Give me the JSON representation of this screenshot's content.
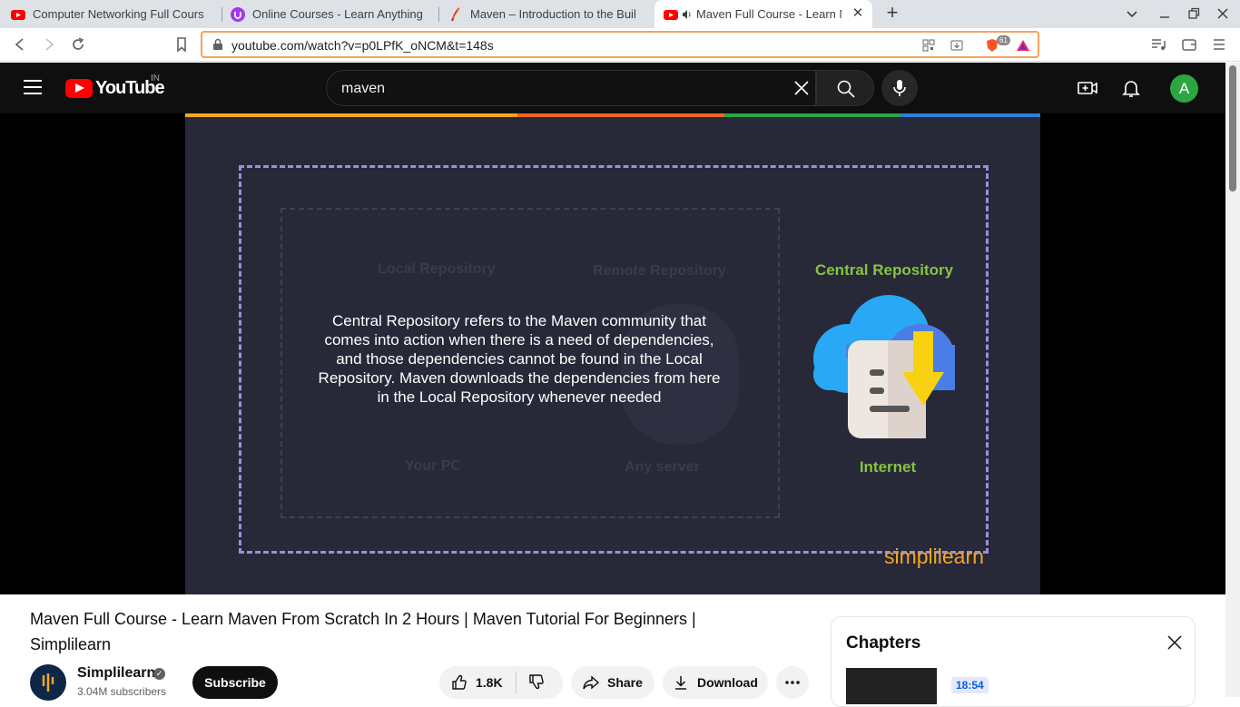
{
  "browser": {
    "tabs": [
      {
        "title": "Computer Networking Full Cours",
        "icon": "youtube-icon"
      },
      {
        "title": "Online Courses - Learn Anything",
        "icon": "udemy-icon"
      },
      {
        "title": "Maven – Introduction to the Buil",
        "icon": "maven-feather-icon"
      },
      {
        "title": "Maven Full Course - Learn M",
        "icon": "youtube-icon",
        "active": true
      }
    ],
    "url": "youtube.com/watch?v=p0LPfK_oNCM&t=148s",
    "brave_shield_count": "61"
  },
  "youtube": {
    "logo_text": "YouTube",
    "country_code": "IN",
    "search_query": "maven",
    "avatar_letter": "A"
  },
  "video": {
    "faded_labels": {
      "local_repo": "Local Repository",
      "remote_repo": "Remote Repository",
      "your_pc": "Your PC",
      "any_server": "Any server"
    },
    "overlay_text": "Central Repository refers to the Maven community that comes into action when there is a need of dependencies, and those dependencies cannot be found in the Local Repository. Maven downloads the dependencies from here in the Local Repository whenever needed",
    "central_repo_label": "Central Repository",
    "internet_label": "Internet",
    "brand": "simplilearn",
    "accent_colors": [
      "#f5a623",
      "#f26522",
      "#27a844",
      "#2e7de0"
    ]
  },
  "meta": {
    "title": "Maven Full Course - Learn Maven From Scratch In 2 Hours | Maven Tutorial For Beginners | Simplilearn",
    "channel": "Simplilearn",
    "subscribers": "3.04M subscribers",
    "subscribe_label": "Subscribe",
    "likes": "1.8K",
    "share_label": "Share",
    "download_label": "Download"
  },
  "chapters": {
    "heading": "Chapters",
    "first_time": "18:54"
  }
}
